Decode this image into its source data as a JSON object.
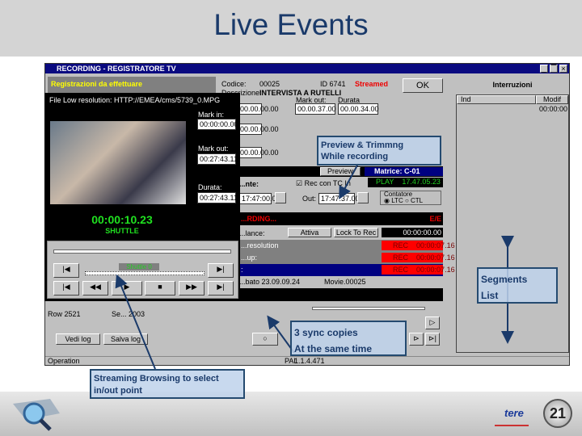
{
  "slide": {
    "title": "Live Events",
    "page_number": "21",
    "logo_text": "tere"
  },
  "window": {
    "title": "RECORDING - REGISTRATORE TV",
    "left_header": "Registrazioni da effettuare",
    "codice_label": "Codice:",
    "codice": "00025",
    "id": "ID 6741",
    "status": "Streamed",
    "descrizione_label": "Descrizione:",
    "descrizione": "INTERVISTA A RUTELLI",
    "mark_out_label": "Mark out:",
    "mark_out_val": "00.00.37.00",
    "durata_label": "Durata",
    "durata_val": "00.00.34.00",
    "field1": "00.00.00.00",
    "field2": "00.00.00.00",
    "field3": "00.00.00.00",
    "ok": "OK",
    "interruzioni": "Interruzioni",
    "col1": "Ind",
    "col2": "Modif",
    "row_val": "00:00:00"
  },
  "preview": {
    "file": "File Low resolution: HTTP://EMEA/cms/5739_0.MPG",
    "mark_in_label": "Mark in:",
    "mark_in": "00:00:00.00",
    "mark_out_label": "Mark out:",
    "mark_out": "00:27:43.11",
    "durata_label": "Durata:",
    "durata": "00:27:43.11",
    "timecode": "00:00:10.23",
    "mode": "SHUTTLE",
    "shuttle_label": "Shuttle 0"
  },
  "recorder": {
    "preview_btn": "Preview",
    "matrice": "Matrice:  C-01",
    "sorgente": "...nte:",
    "rec_tc": "Rec con TC In",
    "play": "PLAY",
    "play_tc": "17.47.05.23",
    "in_val": "17:47:00.00",
    "out_label": "Out:",
    "out_val": "17:47:37.00",
    "contatore": "Contatore",
    "ltc": "LTC",
    "ctl": "CTL",
    "recording": "...RDING...",
    "ee": "E/E",
    "lance_label": "...lance:",
    "attiva": "Attiva",
    "lock": "Lock To Rec",
    "counter": "00:00:00.00",
    "rows": [
      {
        "label": "...resolution",
        "rec": "REC",
        "tc": "00:00:07.16"
      },
      {
        "label": "...up:",
        "rec": "REC",
        "tc": "00:00:07.16"
      },
      {
        "label": ":",
        "rec": "REC",
        "tc": "00:00:07.16"
      }
    ],
    "info1": "...bato 23.09.09.24",
    "info2": "Movie.00025",
    "pal": "PAL",
    "status_val": "1.1.4.471"
  },
  "left": {
    "row1": "Row 2521",
    "row2": "Se... 2003",
    "vedi_log": "Vedi log",
    "salva_log": "Salva log",
    "status": "Operation"
  },
  "callouts": {
    "preview": [
      "Preview & Trimmng",
      "While recording"
    ],
    "segments": [
      "Segments",
      "List"
    ],
    "sync": [
      "3 sync copies",
      "At the same time"
    ],
    "streaming": [
      "Streaming Browsing to  select",
      "in/out point"
    ]
  }
}
